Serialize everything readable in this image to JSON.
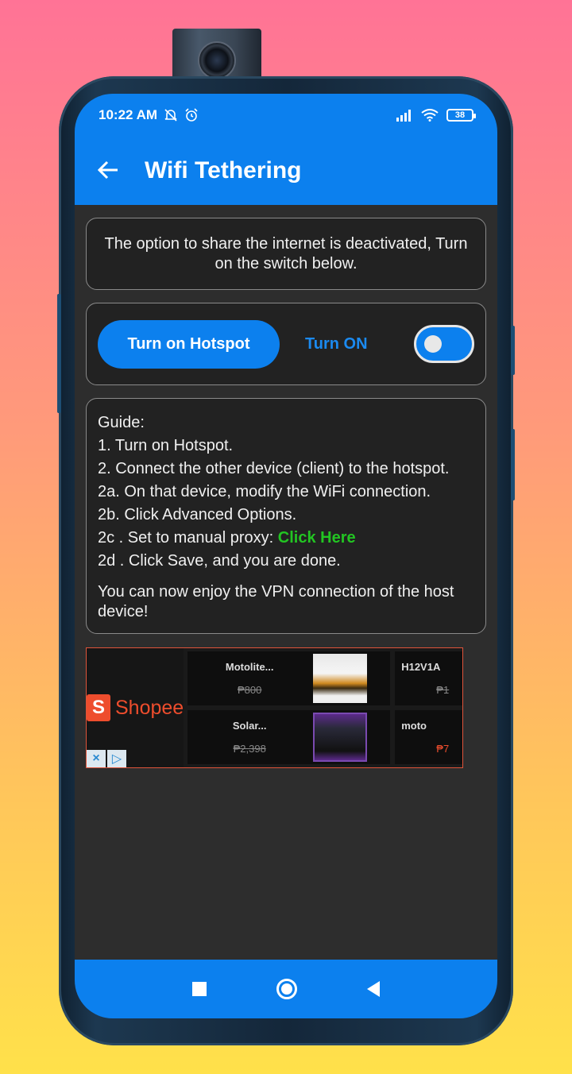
{
  "status_bar": {
    "time": "10:22 AM",
    "battery": "38",
    "icons": [
      "bell-off-icon",
      "alarm-icon",
      "signal-icon",
      "wifi-icon",
      "battery-icon"
    ]
  },
  "app_bar": {
    "title": "Wifi Tethering",
    "back_icon": "back-arrow-icon"
  },
  "notice": {
    "text": "The option to share the internet is deactivated, Turn on the switch below."
  },
  "controls": {
    "hotspot_button": "Turn on Hotspot",
    "state_label": "Turn ON",
    "toggle_on": true
  },
  "guide": {
    "heading": "Guide:",
    "steps": [
      "1. Turn on Hotspot.",
      "2. Connect the other device (client) to the hotspot.",
      "2a. On that device, modify the WiFi connection.",
      "2b. Click Advanced Options.",
      "2c . Set to manual proxy:",
      "2d . Click Save, and you are done."
    ],
    "link": "Click Here",
    "footer": "You can now enjoy the VPN connection of the host device!"
  },
  "ad": {
    "brand": "Shopee",
    "brand_letter": "S",
    "tiles": [
      {
        "name": "Motolite...",
        "price": "₱800"
      },
      {
        "name": "H12V1A",
        "price": "₱1"
      },
      {
        "name": "Solar...",
        "price": "₱2,398"
      },
      {
        "name": "moto",
        "price": "₱7"
      }
    ],
    "close_icon": "×",
    "adchoices_icon": "▷"
  },
  "colors": {
    "accent": "#0c80ee",
    "link_green": "#22c522",
    "background": "#2d2d2d",
    "shopee": "#ee4d2d"
  }
}
